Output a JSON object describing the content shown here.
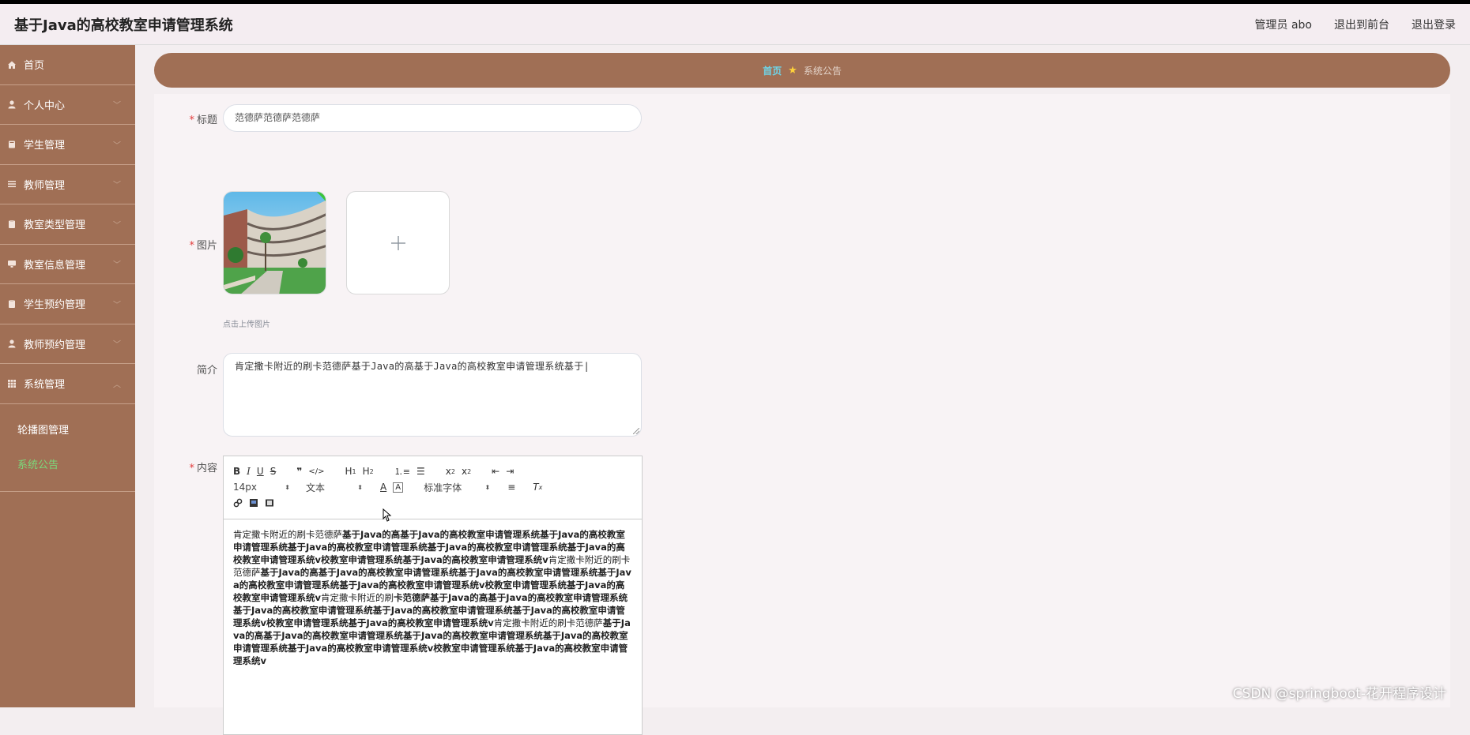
{
  "app": {
    "title": "基于Java的高校教室申请管理系统"
  },
  "header": {
    "user_label": "管理员 abo",
    "front_link": "退出到前台",
    "logout_link": "退出登录"
  },
  "sidebar": {
    "items": [
      {
        "label": "首页",
        "icon": "home-icon"
      },
      {
        "label": "个人中心",
        "icon": "user-icon"
      },
      {
        "label": "学生管理",
        "icon": "book-icon"
      },
      {
        "label": "教师管理",
        "icon": "list-icon"
      },
      {
        "label": "教室类型管理",
        "icon": "clipboard-icon"
      },
      {
        "label": "教室信息管理",
        "icon": "monitor-icon"
      },
      {
        "label": "学生预约管理",
        "icon": "clipboard-icon"
      },
      {
        "label": "教师预约管理",
        "icon": "user-icon"
      },
      {
        "label": "系统管理",
        "icon": "grid-icon"
      }
    ],
    "sub_items": [
      {
        "label": "轮播图管理",
        "active": false
      },
      {
        "label": "系统公告",
        "active": true
      }
    ]
  },
  "breadcrumb": {
    "home": "首页",
    "current": "系统公告"
  },
  "form": {
    "title_label": "标题",
    "title_value": "范德萨范德萨范德萨",
    "image_label": "图片",
    "upload_tip": "点击上传图片",
    "summary_label": "简介",
    "summary_value": "肯定撒卡附近的刷卡范德萨基于Java的高基于Java的高校教室申请管理系统基于|",
    "content_label": "内容"
  },
  "editor": {
    "font_size": "14px",
    "block_type": "文本",
    "font_family": "标准字体",
    "body_thin_1": "肯定撒卡附近的刷卡范德萨",
    "body_1": "基于Java的高基于Java的高校教室申请管理系统基于Java的高校教室申请管理系统基于Java的高校教室申请管理系统基于Java的高校教室申请管理系统基于Java的高校教室申请管理系统v校教室申请管理系统基于Java的高校教室申请管理系统v",
    "body_thin_2": "肯定撒卡附近的刷卡范德萨",
    "body_2": "基于Java的高基于Java的高校教室申请管理系统基于Java的高校教室申请管理系统基于Java的高校教室申请管理系统基于Java的高校教室申请管理系统v校教室申请管理系统基于Java的高校教室申请管理系统v",
    "body_thin_3": "肯定撒卡附近的刷",
    "body_3": "卡范德萨基于Java的高基于Java的高校教室申请管理系统基于Java的高校教室申请管理系统基于Java的高校教室申请管理系统基于Java的高校教室申请管理系统v校教室申请管理系统基于Java的高校教室申请管理系统v",
    "body_thin_4": "肯定撒卡附近的刷卡范德萨",
    "body_4": "基于Java的高基于Java的高校教室申请管理系统基于Java的高校教室申请管理系统基于Java的高校教室申请管理系统基于Java的高校教室申请管理系统v校教室申请管理系统基于Java的高校教室申请管理系统v"
  },
  "watermark": "CSDN @springboot-花开程序设计",
  "colors": {
    "sidebar": "#a06f55",
    "header": "#f4edf1",
    "active_sub": "#7bd97b",
    "breadcrumb_home": "#6fd3e6",
    "required": "#e23c3c"
  }
}
